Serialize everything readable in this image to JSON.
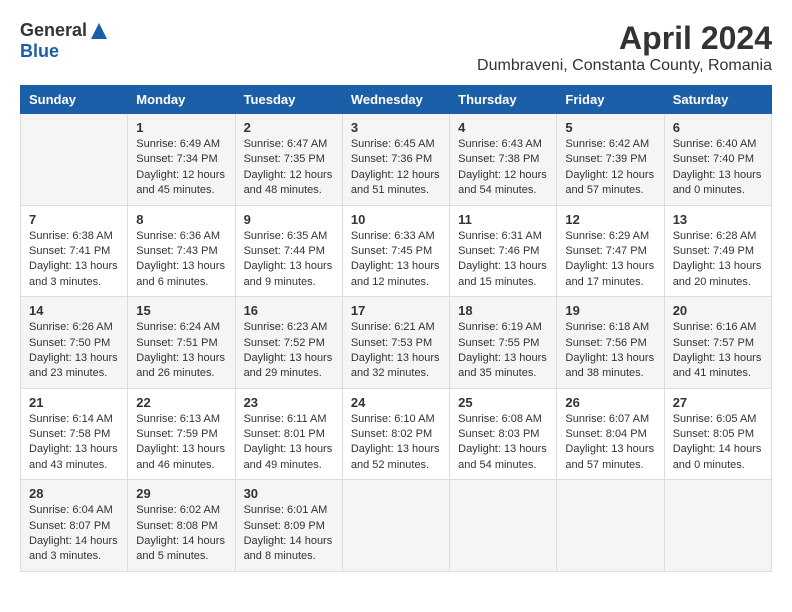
{
  "logo": {
    "general": "General",
    "blue": "Blue"
  },
  "title": "April 2024",
  "location": "Dumbraveni, Constanta County, Romania",
  "days_header": [
    "Sunday",
    "Monday",
    "Tuesday",
    "Wednesday",
    "Thursday",
    "Friday",
    "Saturday"
  ],
  "weeks": [
    [
      {
        "day": "",
        "info": ""
      },
      {
        "day": "1",
        "info": "Sunrise: 6:49 AM\nSunset: 7:34 PM\nDaylight: 12 hours\nand 45 minutes."
      },
      {
        "day": "2",
        "info": "Sunrise: 6:47 AM\nSunset: 7:35 PM\nDaylight: 12 hours\nand 48 minutes."
      },
      {
        "day": "3",
        "info": "Sunrise: 6:45 AM\nSunset: 7:36 PM\nDaylight: 12 hours\nand 51 minutes."
      },
      {
        "day": "4",
        "info": "Sunrise: 6:43 AM\nSunset: 7:38 PM\nDaylight: 12 hours\nand 54 minutes."
      },
      {
        "day": "5",
        "info": "Sunrise: 6:42 AM\nSunset: 7:39 PM\nDaylight: 12 hours\nand 57 minutes."
      },
      {
        "day": "6",
        "info": "Sunrise: 6:40 AM\nSunset: 7:40 PM\nDaylight: 13 hours\nand 0 minutes."
      }
    ],
    [
      {
        "day": "7",
        "info": "Sunrise: 6:38 AM\nSunset: 7:41 PM\nDaylight: 13 hours\nand 3 minutes."
      },
      {
        "day": "8",
        "info": "Sunrise: 6:36 AM\nSunset: 7:43 PM\nDaylight: 13 hours\nand 6 minutes."
      },
      {
        "day": "9",
        "info": "Sunrise: 6:35 AM\nSunset: 7:44 PM\nDaylight: 13 hours\nand 9 minutes."
      },
      {
        "day": "10",
        "info": "Sunrise: 6:33 AM\nSunset: 7:45 PM\nDaylight: 13 hours\nand 12 minutes."
      },
      {
        "day": "11",
        "info": "Sunrise: 6:31 AM\nSunset: 7:46 PM\nDaylight: 13 hours\nand 15 minutes."
      },
      {
        "day": "12",
        "info": "Sunrise: 6:29 AM\nSunset: 7:47 PM\nDaylight: 13 hours\nand 17 minutes."
      },
      {
        "day": "13",
        "info": "Sunrise: 6:28 AM\nSunset: 7:49 PM\nDaylight: 13 hours\nand 20 minutes."
      }
    ],
    [
      {
        "day": "14",
        "info": "Sunrise: 6:26 AM\nSunset: 7:50 PM\nDaylight: 13 hours\nand 23 minutes."
      },
      {
        "day": "15",
        "info": "Sunrise: 6:24 AM\nSunset: 7:51 PM\nDaylight: 13 hours\nand 26 minutes."
      },
      {
        "day": "16",
        "info": "Sunrise: 6:23 AM\nSunset: 7:52 PM\nDaylight: 13 hours\nand 29 minutes."
      },
      {
        "day": "17",
        "info": "Sunrise: 6:21 AM\nSunset: 7:53 PM\nDaylight: 13 hours\nand 32 minutes."
      },
      {
        "day": "18",
        "info": "Sunrise: 6:19 AM\nSunset: 7:55 PM\nDaylight: 13 hours\nand 35 minutes."
      },
      {
        "day": "19",
        "info": "Sunrise: 6:18 AM\nSunset: 7:56 PM\nDaylight: 13 hours\nand 38 minutes."
      },
      {
        "day": "20",
        "info": "Sunrise: 6:16 AM\nSunset: 7:57 PM\nDaylight: 13 hours\nand 41 minutes."
      }
    ],
    [
      {
        "day": "21",
        "info": "Sunrise: 6:14 AM\nSunset: 7:58 PM\nDaylight: 13 hours\nand 43 minutes."
      },
      {
        "day": "22",
        "info": "Sunrise: 6:13 AM\nSunset: 7:59 PM\nDaylight: 13 hours\nand 46 minutes."
      },
      {
        "day": "23",
        "info": "Sunrise: 6:11 AM\nSunset: 8:01 PM\nDaylight: 13 hours\nand 49 minutes."
      },
      {
        "day": "24",
        "info": "Sunrise: 6:10 AM\nSunset: 8:02 PM\nDaylight: 13 hours\nand 52 minutes."
      },
      {
        "day": "25",
        "info": "Sunrise: 6:08 AM\nSunset: 8:03 PM\nDaylight: 13 hours\nand 54 minutes."
      },
      {
        "day": "26",
        "info": "Sunrise: 6:07 AM\nSunset: 8:04 PM\nDaylight: 13 hours\nand 57 minutes."
      },
      {
        "day": "27",
        "info": "Sunrise: 6:05 AM\nSunset: 8:05 PM\nDaylight: 14 hours\nand 0 minutes."
      }
    ],
    [
      {
        "day": "28",
        "info": "Sunrise: 6:04 AM\nSunset: 8:07 PM\nDaylight: 14 hours\nand 3 minutes."
      },
      {
        "day": "29",
        "info": "Sunrise: 6:02 AM\nSunset: 8:08 PM\nDaylight: 14 hours\nand 5 minutes."
      },
      {
        "day": "30",
        "info": "Sunrise: 6:01 AM\nSunset: 8:09 PM\nDaylight: 14 hours\nand 8 minutes."
      },
      {
        "day": "",
        "info": ""
      },
      {
        "day": "",
        "info": ""
      },
      {
        "day": "",
        "info": ""
      },
      {
        "day": "",
        "info": ""
      }
    ]
  ]
}
